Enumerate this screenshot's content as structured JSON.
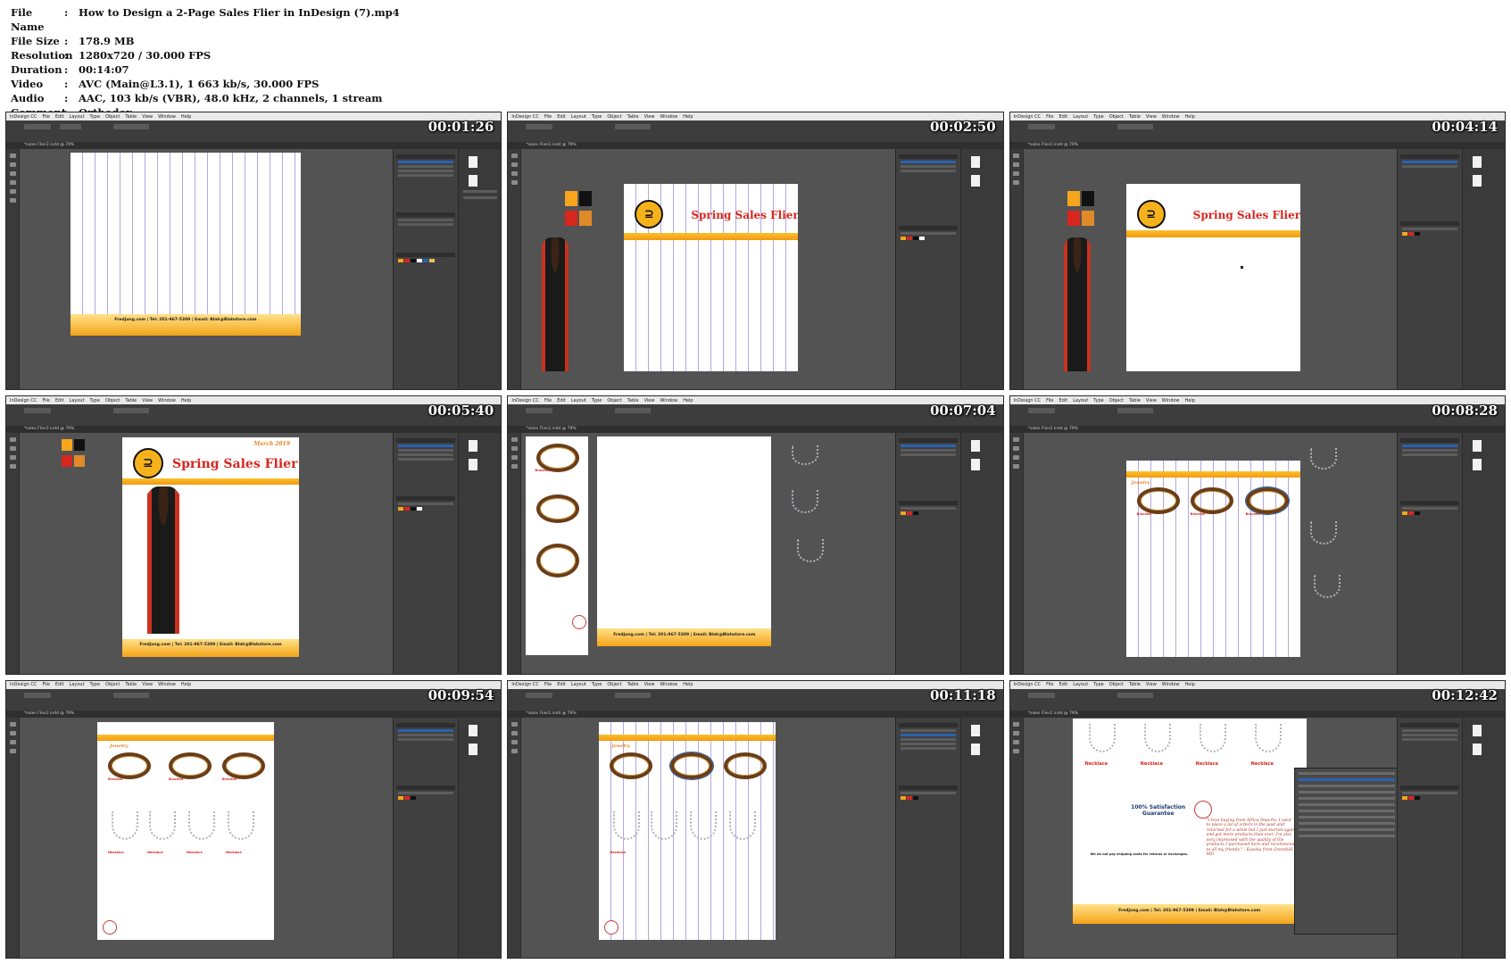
{
  "meta": {
    "rows": [
      {
        "key": "File Name",
        "value": "How to Design a 2-Page Sales Flier in InDesign (7).mp4"
      },
      {
        "key": "File Size",
        "value": "178.9 MB"
      },
      {
        "key": "Resolution",
        "value": "1280x720 / 30.000 FPS"
      },
      {
        "key": "Duration",
        "value": "00:14:07"
      },
      {
        "key": "Video",
        "value": "AVC (Main@L3.1), 1 663 kb/s, 30.000 FPS"
      },
      {
        "key": "Audio",
        "value": "AAC, 103 kb/s (VBR), 48.0 kHz, 2 channels, 1 stream"
      },
      {
        "key": "Comment",
        "value": "Orthodox"
      }
    ],
    "separator": ":"
  },
  "app": {
    "name": "InDesign CC",
    "menu": [
      "File",
      "Edit",
      "Layout",
      "Type",
      "Object",
      "Table",
      "View",
      "Window",
      "Help"
    ],
    "window_title": "Adobe InDesign CC 2019",
    "doc_tab": "*sales Flier2.indd @ 79%"
  },
  "flier": {
    "title": "Spring Sales Flier",
    "date": "March 2019",
    "footer": "Fredjung.com | Tel: 201-967-5309 | Email: Blah@Blahstore.com",
    "section": "Jewelry",
    "item_bracelet": "Bracelet",
    "item_necklace": "Necklace",
    "item_desc": "Fits up to a 8\" wrist; 50\" length; 100% cotton. Made in China. C-7123 $6.95 $5.95",
    "guarantee": "100% Satisfaction Guarantee",
    "testimonial": "\"I love buying from Africa Imports. I used to place a lot of orders in the past and returned for a while but I just started again and got more products than ever. I'm also very impressed with the quality of the products I purchased here and recommend to all my friends.\" - Kaseba from Greenhill, MD",
    "shipping_note": "We do not pay shipping costs for returns or exchanges."
  },
  "thumbnails": [
    {
      "timestamp": "00:01:26"
    },
    {
      "timestamp": "00:02:50"
    },
    {
      "timestamp": "00:04:14"
    },
    {
      "timestamp": "00:05:40"
    },
    {
      "timestamp": "00:07:04"
    },
    {
      "timestamp": "00:08:28"
    },
    {
      "timestamp": "00:09:54"
    },
    {
      "timestamp": "00:11:18"
    },
    {
      "timestamp": "00:12:42"
    }
  ],
  "colors": {
    "ui_dark": "#535353",
    "accent_orange": "#f6a51c",
    "title_red": "#d7261e",
    "selection_blue": "#2a62b0"
  }
}
